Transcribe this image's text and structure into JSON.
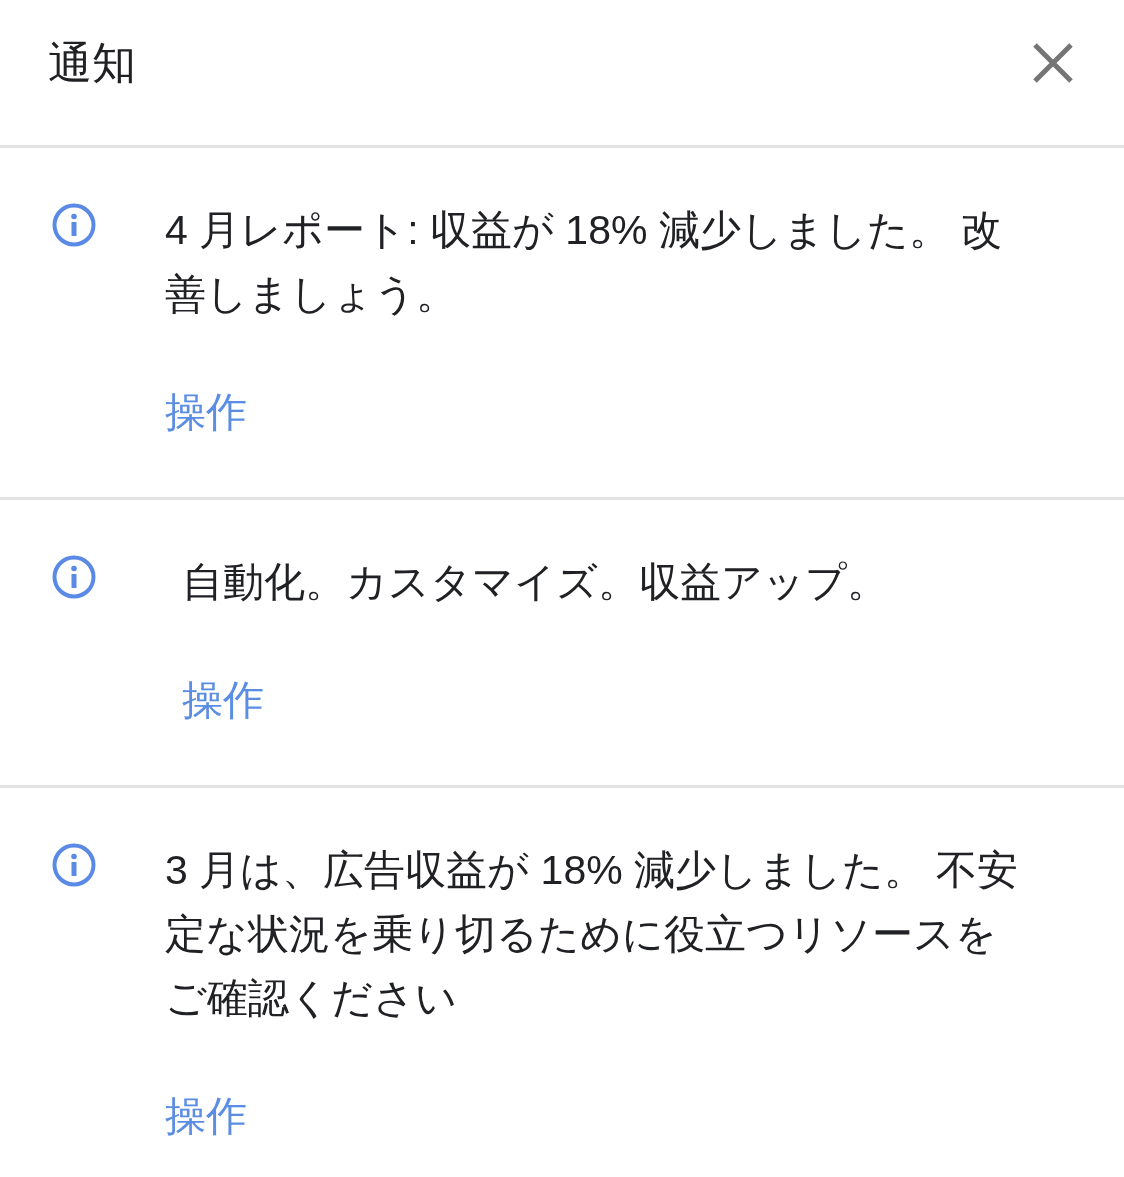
{
  "header": {
    "title": "通知"
  },
  "notifications": [
    {
      "message": "4 月レポート: 収益が 18% 減少しました。 改善しましょう。",
      "action": "操作"
    },
    {
      "message": "自動化。カスタマイズ。収益アップ。",
      "action": "操作"
    },
    {
      "message": "3 月は、広告収益が 18% 減少しました。 不安定な状況を乗り切るために役立つリソースをご確認ください",
      "action": "操作"
    }
  ]
}
